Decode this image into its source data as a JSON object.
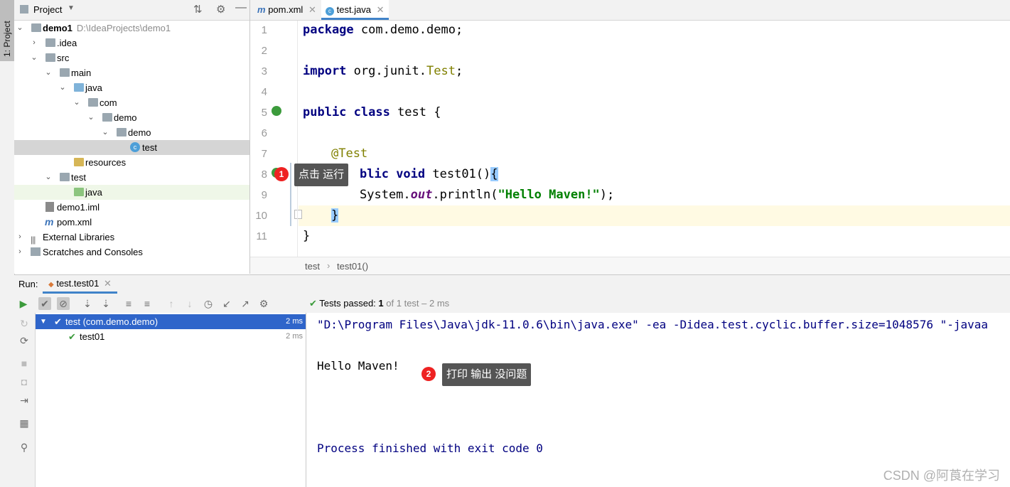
{
  "sidebar_tab": {
    "label": "1: Project"
  },
  "project": {
    "header_label": "Project",
    "tree": [
      {
        "label": "demo1",
        "path": "D:\\IdeaProjects\\demo1"
      },
      {
        "label": ".idea"
      },
      {
        "label": "src"
      },
      {
        "label": "main"
      },
      {
        "label": "java"
      },
      {
        "label": "com"
      },
      {
        "label": "demo"
      },
      {
        "label": "demo"
      },
      {
        "label": "test"
      },
      {
        "label": "resources"
      },
      {
        "label": "test"
      },
      {
        "label": "java"
      },
      {
        "label": "demo1.iml"
      },
      {
        "label": "pom.xml"
      },
      {
        "label": "External Libraries"
      },
      {
        "label": "Scratches and Consoles"
      }
    ]
  },
  "editor": {
    "tabs": [
      {
        "label": "pom.xml"
      },
      {
        "label": "test.java"
      }
    ],
    "line_numbers": [
      "1",
      "2",
      "3",
      "4",
      "5",
      "6",
      "7",
      "8",
      "9",
      "10",
      "11"
    ],
    "code": {
      "l1_kw": "package",
      "l1_rest": " com.demo.demo;",
      "l3_kw": "import",
      "l3_pkg": " org.junit.",
      "l3_cls": "Test",
      "l3_end": ";",
      "l5_kw": "public class",
      "l5_rest": " test {",
      "l7_ann": "@Test",
      "l8_kw1": "blic",
      "l8_kw2": " void",
      "l8_rest": " test01()",
      "l8_brace": "{",
      "l9_a": "System.",
      "l9_b": "out",
      "l9_c": ".println(",
      "l9_str": "\"Hello Maven!\"",
      "l9_d": ");",
      "l10": "}",
      "l11": "}"
    },
    "breadcrumb": [
      "test",
      "test01()"
    ]
  },
  "annotations": {
    "tip1": {
      "num": "1",
      "text": "点击 运行"
    },
    "tip2": {
      "num": "2",
      "text": "打印 输出 没问题"
    }
  },
  "run": {
    "label": "Run:",
    "tab": "test.test01",
    "status_prefix": "Tests passed:",
    "status_count": "1",
    "status_suffix": "of 1 test – 2 ms",
    "tree": [
      {
        "label": "test (com.demo.demo)",
        "time": "2 ms"
      },
      {
        "label": "test01",
        "time": "2 ms"
      }
    ],
    "console": {
      "cmd": "\"D:\\Program Files\\Java\\jdk-11.0.6\\bin\\java.exe\" -ea -Didea.test.cyclic.buffer.size=1048576 \"-javaa",
      "output": "Hello Maven!",
      "exit": "Process finished with exit code 0"
    }
  },
  "watermark": "CSDN @阿莨在学习"
}
